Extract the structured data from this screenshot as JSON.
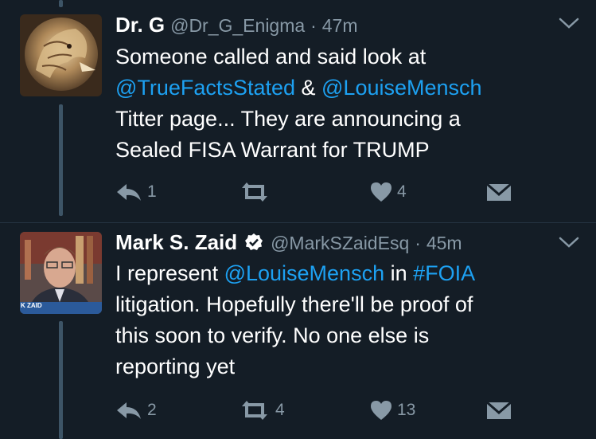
{
  "tweets": [
    {
      "display_name": "Dr. G",
      "handle": "@Dr_G_Enigma",
      "separator": "·",
      "time": "47m",
      "text": {
        "line1": "Someone called and said look at",
        "mention1": "@TrueFactsStated",
        "amp": " & ",
        "mention2": "@LouiseMensch",
        "line3": "Titter page... They are announcing a",
        "line4": "Sealed FISA Warrant for TRUMP"
      },
      "actions": {
        "reply_count": "1",
        "retweet_count": "",
        "like_count": "4"
      }
    },
    {
      "display_name": "Mark S. Zaid",
      "verified": true,
      "handle": "@MarkSZaidEsq",
      "separator": "·",
      "time": "45m",
      "avatar_caption": "K ZAID",
      "text": {
        "pre1": "I represent ",
        "mention1": "@LouiseMensch",
        "mid1": " in ",
        "hashtag": "#FOIA",
        "line2": "litigation. Hopefully there'll be proof of",
        "line3": "this soon to verify. No one else is",
        "line4": "reporting yet"
      },
      "actions": {
        "reply_count": "2",
        "retweet_count": "4",
        "like_count": "13"
      }
    }
  ],
  "colors": {
    "background": "#141d26",
    "link": "#1da1f2",
    "muted": "#8899a6",
    "thread_line": "#3d5466"
  }
}
